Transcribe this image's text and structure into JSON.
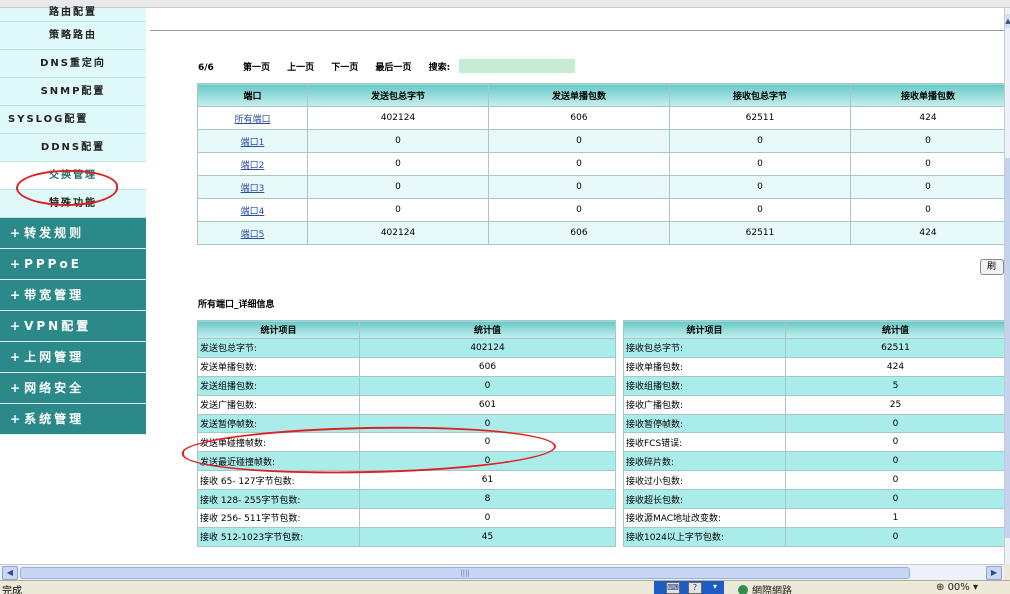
{
  "sidebar": {
    "sub_items": [
      "路由配置",
      "策略路由",
      "DNS重定向",
      "SNMP配置",
      "SYSLOG配置",
      "DDNS配置",
      "交换管理",
      "特殊功能"
    ],
    "main_items": [
      "转发规则",
      "PPPoE",
      "带宽管理",
      "VPN配置",
      "上网管理",
      "网络安全",
      "系统管理"
    ],
    "plus": "+"
  },
  "pager": {
    "count": "6/6",
    "first": "第一页",
    "prev": "上一页",
    "next": "下一页",
    "last": "最后一页",
    "search_label": "搜索:",
    "search_value": ""
  },
  "ports_table": {
    "headers": [
      "端口",
      "发送包总字节",
      "发送单播包数",
      "接收包总字节",
      "接收单播包数"
    ],
    "rows": [
      [
        "所有端口",
        "402124",
        "606",
        "62511",
        "424"
      ],
      [
        "端口1",
        "0",
        "0",
        "0",
        "0"
      ],
      [
        "端口2",
        "0",
        "0",
        "0",
        "0"
      ],
      [
        "端口3",
        "0",
        "0",
        "0",
        "0"
      ],
      [
        "端口4",
        "0",
        "0",
        "0",
        "0"
      ],
      [
        "端口5",
        "402124",
        "606",
        "62511",
        "424"
      ]
    ]
  },
  "refresh_label": "刷",
  "detail_title": "所有端口_详细信息",
  "send_stats": {
    "headers": [
      "统计项目",
      "统计值"
    ],
    "rows": [
      [
        "发送包总字节:",
        "402124"
      ],
      [
        "发送单播包数:",
        "606"
      ],
      [
        "发送组播包数:",
        "0"
      ],
      [
        "发送广播包数:",
        "601"
      ],
      [
        "发送暂停帧数:",
        "0"
      ],
      [
        "发送单碰撞帧数:",
        "0"
      ],
      [
        "发送最近碰撞帧数:",
        "0"
      ],
      [
        "接收 65- 127字节包数:",
        "61"
      ],
      [
        "接收 128- 255字节包数:",
        "8"
      ],
      [
        "接收 256- 511字节包数:",
        "0"
      ],
      [
        "接收 512-1023字节包数:",
        "45"
      ]
    ]
  },
  "recv_stats": {
    "headers": [
      "统计项目",
      "统计值"
    ],
    "rows": [
      [
        "接收包总字节:",
        "62511"
      ],
      [
        "接收单播包数:",
        "424"
      ],
      [
        "接收组播包数:",
        "5"
      ],
      [
        "接收广播包数:",
        "25"
      ],
      [
        "接收暂停帧数:",
        "0"
      ],
      [
        "接收FCS错误:",
        "0"
      ],
      [
        "接收碎片数:",
        "0"
      ],
      [
        "接收过小包数:",
        "0"
      ],
      [
        "接收超长包数:",
        "0"
      ],
      [
        "接收源MAC地址改变数:",
        "1"
      ],
      [
        "接收1024以上字节包数:",
        "0"
      ]
    ]
  },
  "statusbar": {
    "done": "完成",
    "zone": "網際網路",
    "zoom": "00%"
  },
  "scroll": {
    "h_thumb_grip": "||||"
  },
  "colors": {
    "sidebar_main": "#2b8a89",
    "sidebar_sub": "#dff8f8",
    "row_cyan": "#a9ecea",
    "annotation": "#e02020"
  }
}
